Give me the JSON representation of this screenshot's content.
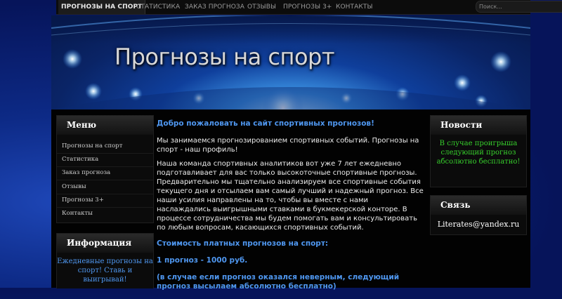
{
  "nav": {
    "items": [
      "ПРОГНОЗЫ НА СПОРТ",
      "СТАТИСТИКА",
      "ЗАКАЗ ПРОГНОЗА",
      "ОТЗЫВЫ",
      "ПРОГНОЗЫ 3+",
      "КОНТАКТЫ"
    ],
    "active_index": 0
  },
  "search": {
    "placeholder": "Поиск...",
    "icon": "search-icon"
  },
  "banner": {
    "title": "Прогнозы на спорт"
  },
  "sidebar_menu": {
    "title": "Меню",
    "items": [
      "Прогнозы на спорт",
      "Статистика",
      "Заказ прогноза",
      "Отзывы",
      "Прогнозы 3+",
      "Контакты"
    ]
  },
  "info": {
    "title": "Информация",
    "text": "Ежедневные прогнозы на спорт! Ставь и выигрывай!"
  },
  "content": {
    "welcome": "Добро пожаловать на сайт спортивных прогнозов!",
    "p1": "Мы занимаемся прогнозированием спортивных событий. Прогнозы на спорт - наш профиль!",
    "p2": "Наша команда спортивных аналитиков вот уже 7 лет ежедневно подготавливает для вас только высокоточные спортивные прогнозы. Предварительно мы тщательно анализируем все спортивные события текущего дня и отсылаем вам самый лучший и надежный прогноз. Все наши усилия направлены на то, чтобы вы вместе с нами наслаждались выигрышными ставками в букмекерской конторе. В процессе сотрудничества мы будем помогать вам и консультировать по любым вопросам, касающихся спортивных событий.",
    "price_heading": "Стоимость платных прогнозов на спорт:",
    "price": "1 прогноз - 1000 руб.",
    "guarantee": "(в случае если прогноз оказался неверным, следующий прогноз высылаем абсолютно бесплатно)"
  },
  "news": {
    "title": "Новости",
    "text": "В случае проигрыша следующий прогноз абсолютно бесплатно!"
  },
  "contact": {
    "title": "Связь",
    "email": "Literates@yandex.ru"
  },
  "colors": {
    "accent_blue": "#4f97f0",
    "news_green": "#37d02c",
    "background": "#06145a",
    "panel": "#0b0b0b"
  }
}
